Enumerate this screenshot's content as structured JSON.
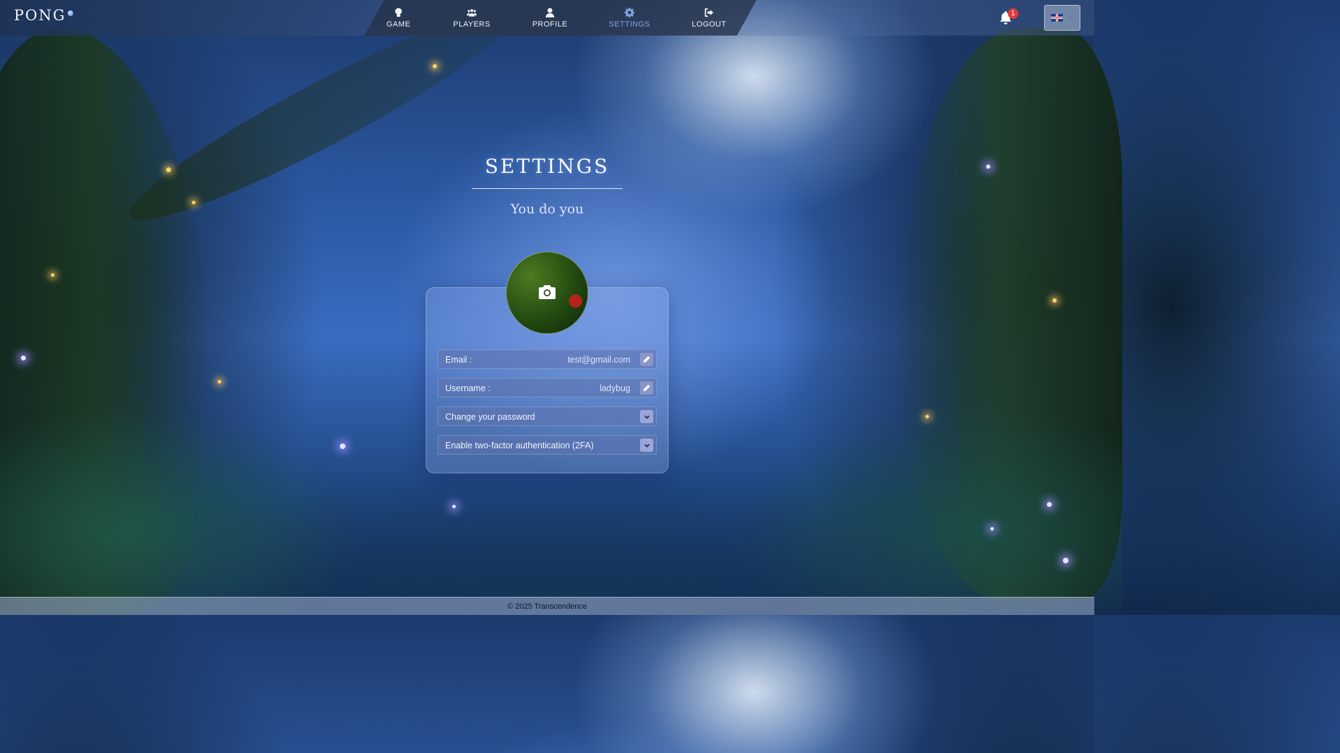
{
  "app": {
    "logo_text": "PONG"
  },
  "nav": {
    "items": [
      {
        "label": "GAME",
        "icon": "game-icon"
      },
      {
        "label": "PLAYERS",
        "icon": "players-icon"
      },
      {
        "label": "PROFILE",
        "icon": "profile-icon"
      },
      {
        "label": "SETTINGS",
        "icon": "gear-icon",
        "active": true
      },
      {
        "label": "LOGOUT",
        "icon": "logout-icon"
      }
    ],
    "active_color": "#7fa6e6"
  },
  "notifications": {
    "count": "1",
    "icon": "bell-icon",
    "badge_color": "#e23b3b"
  },
  "language": {
    "selected": "uk-flag-icon"
  },
  "page": {
    "title": "SETTINGS",
    "subtitle": "You do you"
  },
  "settings": {
    "avatar_icon": "camera-icon",
    "email": {
      "label": "Email :",
      "value": "test@gmail.com"
    },
    "username": {
      "label": "Username :",
      "value": "ladybug"
    },
    "password": {
      "label": "Change your password"
    },
    "twofa": {
      "label": "Enable two-factor authentication (2FA)"
    }
  },
  "footer": {
    "text": "© 2025 Transcendence"
  }
}
